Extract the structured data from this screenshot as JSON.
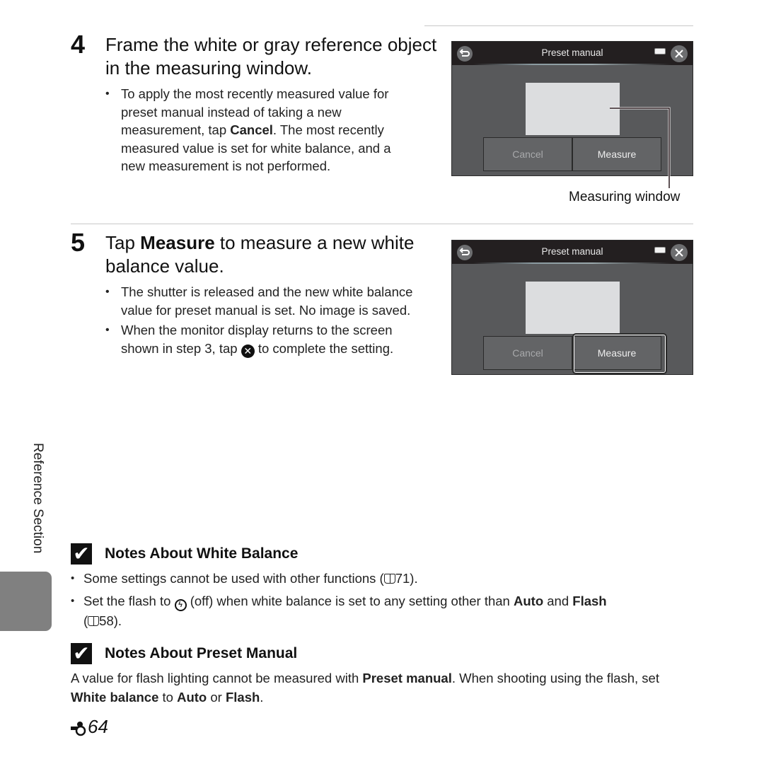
{
  "step4": {
    "number": "4",
    "title": "Frame the white or gray reference object in the measuring window.",
    "bullets": [
      {
        "parts": [
          "To apply the most recently measured value for preset manual instead of taking a new measurement, tap ",
          "Cancel",
          ". The most recently measured value is set for white balance, and a new measurement is not performed."
        ]
      }
    ],
    "screen": {
      "title": "Preset manual",
      "cancel_label": "Cancel",
      "measure_label": "Measure",
      "back_icon": "back-arrow-icon",
      "close_icon": "close-icon",
      "battery_icon": "battery-icon"
    },
    "callout_label": "Measuring window"
  },
  "step5": {
    "number": "5",
    "title_parts": [
      "Tap ",
      "Measure",
      " to measure a new white balance value."
    ],
    "bullets": [
      {
        "text": "The shutter is released and the new white balance value for preset manual is set. No image is saved."
      },
      {
        "parts": [
          "When the monitor display returns to the screen shown in step 3, tap ",
          " to complete the setting."
        ],
        "icon": "close-circle-icon"
      }
    ],
    "screen": {
      "title": "Preset manual",
      "cancel_label": "Cancel",
      "measure_label": "Measure",
      "highlighted": "Measure"
    }
  },
  "sidebar": {
    "section_label": "Reference Section"
  },
  "notes_white_balance": {
    "heading": "Notes About White Balance",
    "bullets": [
      {
        "parts": [
          "Some settings cannot be used with other functions (",
          "71",
          ")."
        ]
      },
      {
        "parts": [
          "Set the flash to ",
          " (off) when white balance is set to any setting other than ",
          "Auto",
          " and ",
          "Flash",
          " (",
          "58",
          ")."
        ]
      }
    ]
  },
  "notes_preset_manual": {
    "heading": "Notes About Preset Manual",
    "parts": [
      "A value for flash lighting cannot be measured with ",
      "Preset manual",
      ". When shooting using the flash, set ",
      "White balance",
      " to ",
      "Auto",
      " or ",
      "Flash",
      "."
    ]
  },
  "footer": {
    "page_prefix_icon": "reference-section-icon",
    "page_number": "64"
  }
}
